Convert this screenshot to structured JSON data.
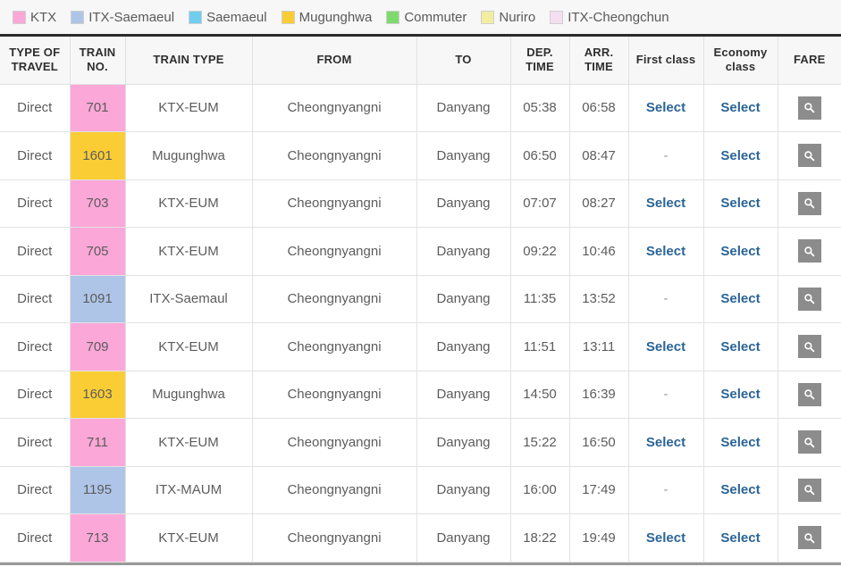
{
  "legend": {
    "items": [
      {
        "label": "KTX",
        "color": "#fba7d8"
      },
      {
        "label": "ITX-Saemaeul",
        "color": "#aec5e8"
      },
      {
        "label": "Saemaeul",
        "color": "#6fcdf0"
      },
      {
        "label": "Mugunghwa",
        "color": "#fbcd35"
      },
      {
        "label": "Commuter",
        "color": "#7ddb6d"
      },
      {
        "label": "Nuriro",
        "color": "#f3edA0"
      },
      {
        "label": "ITX-Cheongchun",
        "color": "#f3dff0"
      }
    ]
  },
  "table": {
    "headers": [
      "TYPE OF TRAVEL",
      "TRAIN NO.",
      "TRAIN TYPE",
      "FROM",
      "TO",
      "DEP. TIME",
      "ARR. TIME",
      "First class",
      "Economy class",
      "FARE"
    ],
    "select_label": "Select",
    "unavailable_label": "-",
    "fare_icon": "search-icon",
    "rows": [
      {
        "type_of_travel": "Direct",
        "train_no": "701",
        "train_no_color": "#fba7d8",
        "train_type": "KTX-EUM",
        "from": "Cheongnyangni",
        "to": "Danyang",
        "dep_time": "05:38",
        "arr_time": "06:58",
        "first_class": "Select",
        "economy_class": "Select"
      },
      {
        "type_of_travel": "Direct",
        "train_no": "1601",
        "train_no_color": "#fbcd35",
        "train_type": "Mugunghwa",
        "from": "Cheongnyangni",
        "to": "Danyang",
        "dep_time": "06:50",
        "arr_time": "08:47",
        "first_class": "-",
        "economy_class": "Select"
      },
      {
        "type_of_travel": "Direct",
        "train_no": "703",
        "train_no_color": "#fba7d8",
        "train_type": "KTX-EUM",
        "from": "Cheongnyangni",
        "to": "Danyang",
        "dep_time": "07:07",
        "arr_time": "08:27",
        "first_class": "Select",
        "economy_class": "Select"
      },
      {
        "type_of_travel": "Direct",
        "train_no": "705",
        "train_no_color": "#fba7d8",
        "train_type": "KTX-EUM",
        "from": "Cheongnyangni",
        "to": "Danyang",
        "dep_time": "09:22",
        "arr_time": "10:46",
        "first_class": "Select",
        "economy_class": "Select"
      },
      {
        "type_of_travel": "Direct",
        "train_no": "1091",
        "train_no_color": "#aec5e8",
        "train_type": "ITX-Saemaul",
        "from": "Cheongnyangni",
        "to": "Danyang",
        "dep_time": "11:35",
        "arr_time": "13:52",
        "first_class": "-",
        "economy_class": "Select"
      },
      {
        "type_of_travel": "Direct",
        "train_no": "709",
        "train_no_color": "#fba7d8",
        "train_type": "KTX-EUM",
        "from": "Cheongnyangni",
        "to": "Danyang",
        "dep_time": "11:51",
        "arr_time": "13:11",
        "first_class": "Select",
        "economy_class": "Select"
      },
      {
        "type_of_travel": "Direct",
        "train_no": "1603",
        "train_no_color": "#fbcd35",
        "train_type": "Mugunghwa",
        "from": "Cheongnyangni",
        "to": "Danyang",
        "dep_time": "14:50",
        "arr_time": "16:39",
        "first_class": "-",
        "economy_class": "Select"
      },
      {
        "type_of_travel": "Direct",
        "train_no": "711",
        "train_no_color": "#fba7d8",
        "train_type": "KTX-EUM",
        "from": "Cheongnyangni",
        "to": "Danyang",
        "dep_time": "15:22",
        "arr_time": "16:50",
        "first_class": "Select",
        "economy_class": "Select"
      },
      {
        "type_of_travel": "Direct",
        "train_no": "1195",
        "train_no_color": "#aec5e8",
        "train_type": "ITX-MAUM",
        "from": "Cheongnyangni",
        "to": "Danyang",
        "dep_time": "16:00",
        "arr_time": "17:49",
        "first_class": "-",
        "economy_class": "Select"
      },
      {
        "type_of_travel": "Direct",
        "train_no": "713",
        "train_no_color": "#fba7d8",
        "train_type": "KTX-EUM",
        "from": "Cheongnyangni",
        "to": "Danyang",
        "dep_time": "18:22",
        "arr_time": "19:49",
        "first_class": "Select",
        "economy_class": "Select"
      }
    ]
  }
}
